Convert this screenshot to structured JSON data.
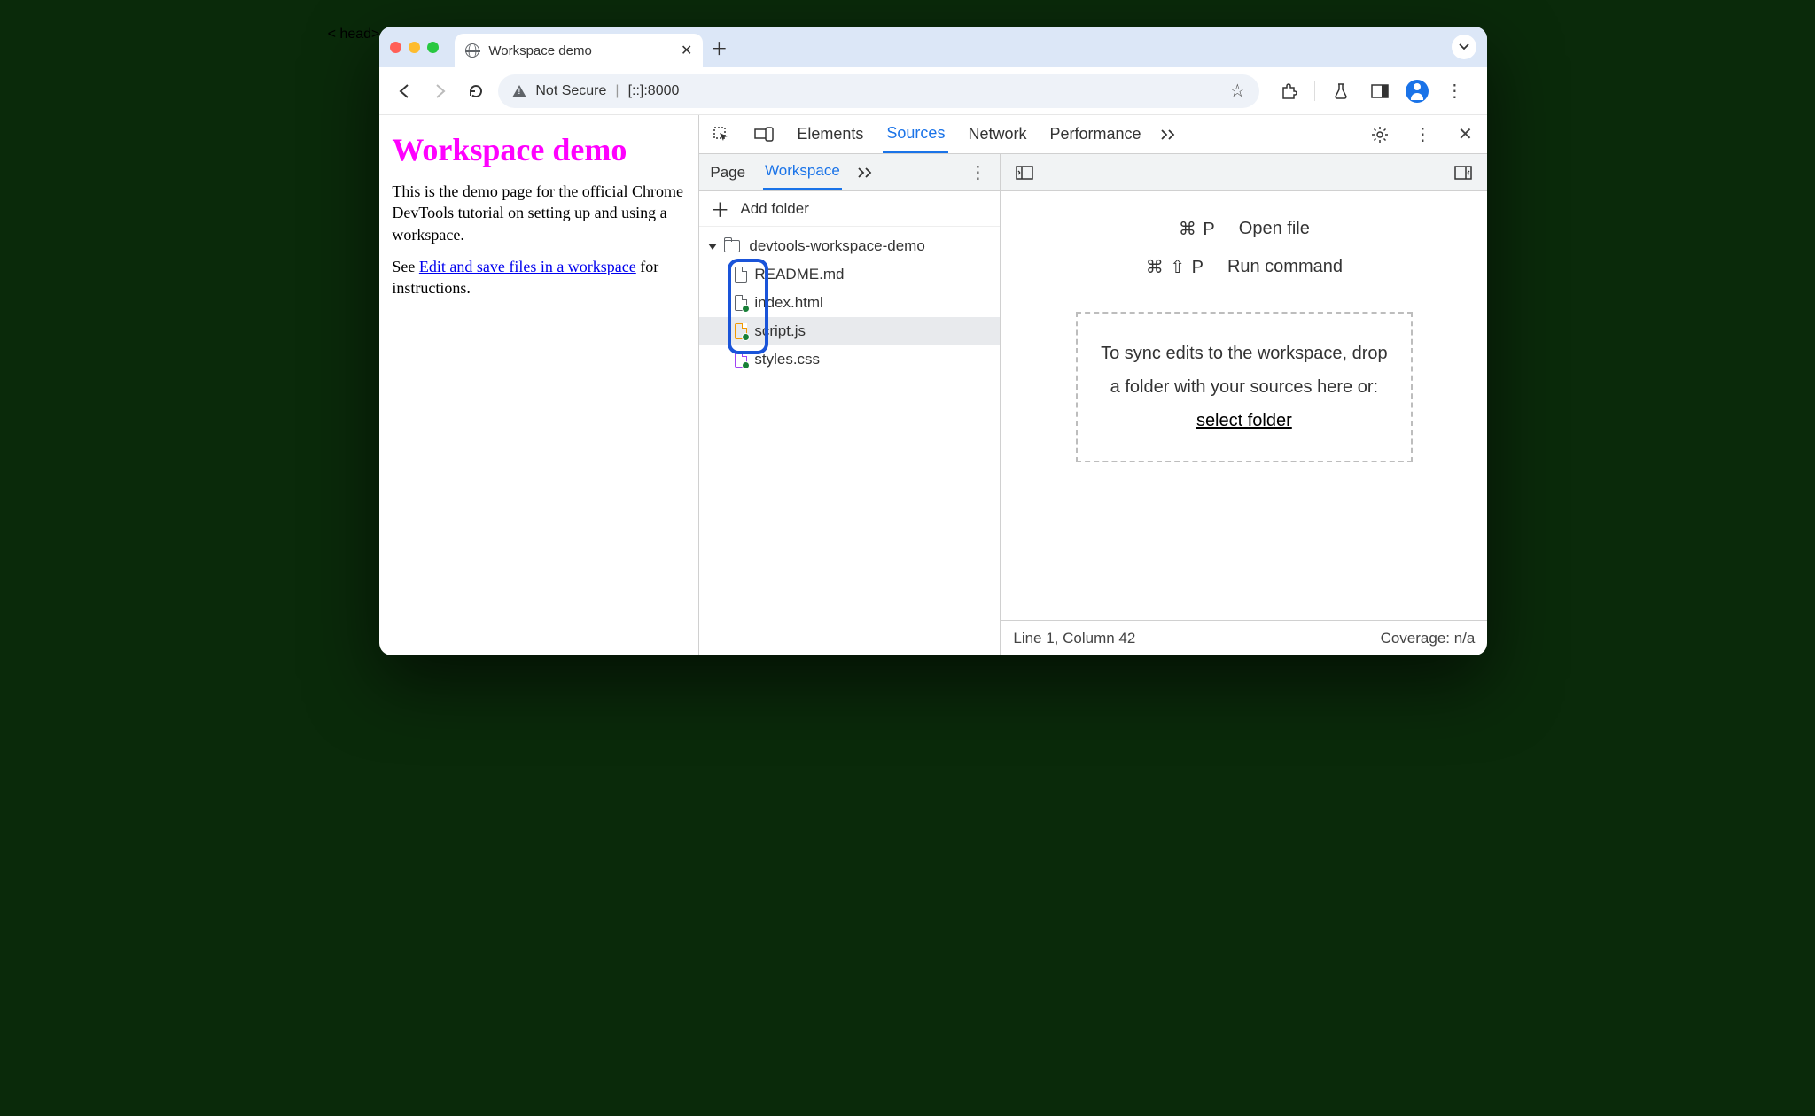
{
  "browser": {
    "tab_title": "Workspace demo",
    "address_security": "Not Secure",
    "address_url": "[::]:8000"
  },
  "page": {
    "heading": "Workspace demo",
    "para1": "This is the demo page for the official Chrome DevTools tutorial on setting up and using a workspace.",
    "para2_pre": "See ",
    "para2_link": "Edit and save files in a workspace",
    "para2_post": " for instructions."
  },
  "devtools": {
    "tabs": {
      "elements": "Elements",
      "sources": "Sources",
      "network": "Network",
      "performance": "Performance"
    },
    "sources_tabs": {
      "page": "Page",
      "workspace": "Workspace"
    },
    "add_folder": "Add folder",
    "tree": {
      "root": "devtools-workspace-demo",
      "files": [
        "README.md",
        "index.html",
        "script.js",
        "styles.css"
      ]
    },
    "cmds": {
      "open_kbd": "⌘ P",
      "open_label": "Open file",
      "run_kbd": "⌘ ⇧ P",
      "run_label": "Run command"
    },
    "drop": {
      "line1": "To sync edits to the workspace, drop",
      "line2": "a folder with your sources here or:",
      "link": "select folder"
    },
    "status": {
      "pos": "Line 1, Column 42",
      "cov": "Coverage: n/a"
    }
  }
}
